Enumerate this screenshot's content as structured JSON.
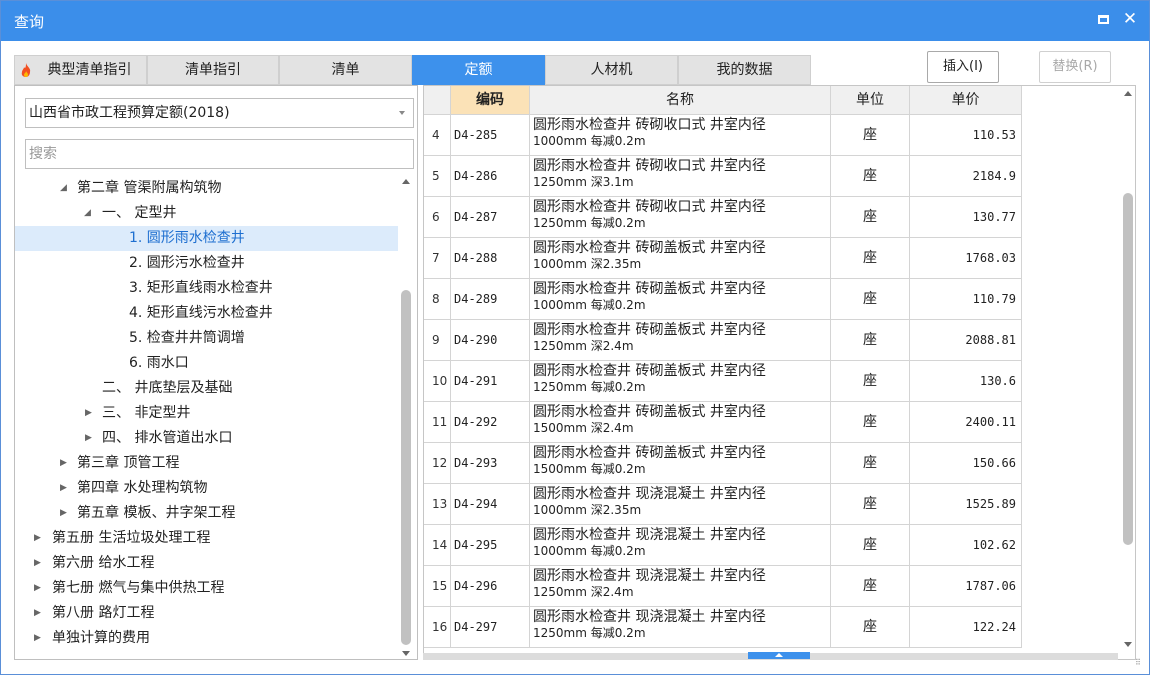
{
  "window": {
    "title": "查询"
  },
  "tabs": [
    {
      "label": "典型清单指引",
      "icon": "flame-icon"
    },
    {
      "label": "清单指引"
    },
    {
      "label": "清单"
    },
    {
      "label": "定额",
      "active": true
    },
    {
      "label": "人材机"
    },
    {
      "label": "我的数据"
    }
  ],
  "buttons": {
    "insert": "插入(I)",
    "replace": "替换(R)"
  },
  "left": {
    "quota_db": "山西省市政工程预算定额(2018)",
    "search_placeholder": "搜索",
    "tree": [
      {
        "label": "第二章 管渠附属构筑物",
        "expanded": true
      },
      {
        "label": "一、 定型井",
        "expanded": true
      },
      {
        "label": "1. 圆形雨水检查井",
        "selected": true
      },
      {
        "label": "2. 圆形污水检查井"
      },
      {
        "label": "3. 矩形直线雨水检查井"
      },
      {
        "label": "4. 矩形直线污水检查井"
      },
      {
        "label": "5. 检查井井筒调增"
      },
      {
        "label": "6. 雨水口"
      },
      {
        "label": "二、 井底垫层及基础"
      },
      {
        "label": "三、 非定型井",
        "expanded": false
      },
      {
        "label": "四、 排水管道出水口",
        "expanded": false
      },
      {
        "label": "第三章 顶管工程",
        "expanded": false
      },
      {
        "label": "第四章 水处理构筑物",
        "expanded": false
      },
      {
        "label": "第五章 模板、井字架工程",
        "expanded": false
      },
      {
        "label": "第五册 生活垃圾处理工程",
        "expanded": false
      },
      {
        "label": "第六册 给水工程",
        "expanded": false
      },
      {
        "label": "第七册 燃气与集中供热工程",
        "expanded": false
      },
      {
        "label": "第八册 路灯工程",
        "expanded": false
      },
      {
        "label": "单独计算的费用",
        "expanded": false
      }
    ]
  },
  "grid": {
    "headers": {
      "rownum": "",
      "code": "编码",
      "name": "名称",
      "unit": "单位",
      "price": "单价"
    },
    "rows": [
      {
        "n": "4",
        "code": "D4-285",
        "name1": "圆形雨水检查井 砖砌收口式 井室内径",
        "name2": "1000mm 每减0.2m",
        "unit": "座",
        "price": "110.53"
      },
      {
        "n": "5",
        "code": "D4-286",
        "name1": "圆形雨水检查井 砖砌收口式 井室内径",
        "name2": "1250mm 深3.1m",
        "unit": "座",
        "price": "2184.9"
      },
      {
        "n": "6",
        "code": "D4-287",
        "name1": "圆形雨水检查井 砖砌收口式 井室内径",
        "name2": "1250mm 每减0.2m",
        "unit": "座",
        "price": "130.77"
      },
      {
        "n": "7",
        "code": "D4-288",
        "name1": "圆形雨水检查井 砖砌盖板式 井室内径",
        "name2": "1000mm 深2.35m",
        "unit": "座",
        "price": "1768.03"
      },
      {
        "n": "8",
        "code": "D4-289",
        "name1": "圆形雨水检查井 砖砌盖板式 井室内径",
        "name2": "1000mm 每减0.2m",
        "unit": "座",
        "price": "110.79"
      },
      {
        "n": "9",
        "code": "D4-290",
        "name1": "圆形雨水检查井 砖砌盖板式 井室内径",
        "name2": "1250mm 深2.4m",
        "unit": "座",
        "price": "2088.81"
      },
      {
        "n": "10",
        "code": "D4-291",
        "name1": "圆形雨水检查井 砖砌盖板式 井室内径",
        "name2": "1250mm 每减0.2m",
        "unit": "座",
        "price": "130.6"
      },
      {
        "n": "11",
        "code": "D4-292",
        "name1": "圆形雨水检查井 砖砌盖板式 井室内径",
        "name2": "1500mm 深2.4m",
        "unit": "座",
        "price": "2400.11"
      },
      {
        "n": "12",
        "code": "D4-293",
        "name1": "圆形雨水检查井 砖砌盖板式 井室内径",
        "name2": "1500mm 每减0.2m",
        "unit": "座",
        "price": "150.66"
      },
      {
        "n": "13",
        "code": "D4-294",
        "name1": "圆形雨水检查井 现浇混凝土 井室内径",
        "name2": "1000mm 深2.35m",
        "unit": "座",
        "price": "1525.89"
      },
      {
        "n": "14",
        "code": "D4-295",
        "name1": "圆形雨水检查井 现浇混凝土 井室内径",
        "name2": "1000mm 每减0.2m",
        "unit": "座",
        "price": "102.62"
      },
      {
        "n": "15",
        "code": "D4-296",
        "name1": "圆形雨水检查井 现浇混凝土 井室内径",
        "name2": "1250mm 深2.4m",
        "unit": "座",
        "price": "1787.06"
      },
      {
        "n": "16",
        "code": "D4-297",
        "name1": "圆形雨水检查井 现浇混凝土 井室内径",
        "name2": "1250mm 每减0.2m",
        "unit": "座",
        "price": "122.24"
      }
    ]
  },
  "colors": {
    "accent": "#3b8eea",
    "selected_bg": "#dcebfb",
    "sort_header": "#fbe2b7"
  }
}
